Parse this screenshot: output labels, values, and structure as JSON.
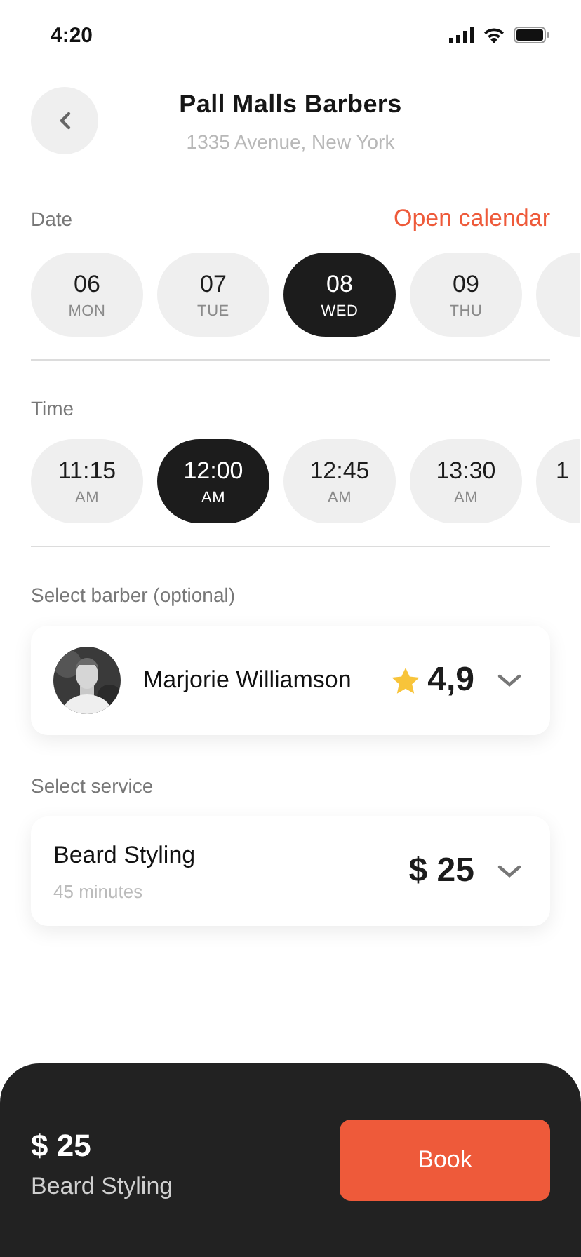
{
  "status_bar": {
    "time": "4:20"
  },
  "header": {
    "title": "Pall Malls Barbers",
    "address": "1335 Avenue, New York"
  },
  "date": {
    "label": "Date",
    "action": "Open calendar",
    "days": [
      {
        "kind": "pill",
        "number": "06",
        "weekday": "MON",
        "selected": false
      },
      {
        "kind": "pill",
        "number": "07",
        "weekday": "TUE",
        "selected": false
      },
      {
        "kind": "pill",
        "number": "08",
        "weekday": "WED",
        "selected": true
      },
      {
        "kind": "pill",
        "number": "09",
        "weekday": "THU",
        "selected": false
      },
      {
        "kind": "partial",
        "selected": false
      }
    ]
  },
  "time": {
    "label": "Time",
    "slots": [
      {
        "kind": "pill",
        "time": "11:15",
        "period": "AM",
        "selected": false
      },
      {
        "kind": "pill",
        "time": "12:00",
        "period": "AM",
        "selected": true
      },
      {
        "kind": "pill",
        "time": "12:45",
        "period": "AM",
        "selected": false
      },
      {
        "kind": "pill",
        "time": "13:30",
        "period": "AM",
        "selected": false
      },
      {
        "kind": "partial",
        "time": "1",
        "selected": false
      }
    ]
  },
  "barber": {
    "label": "Select barber (optional)",
    "name": "Marjorie Williamson",
    "rating": "4,9"
  },
  "service": {
    "label": "Select service",
    "name": "Beard Styling",
    "duration": "45 minutes",
    "price": "$ 25"
  },
  "footer": {
    "price": "$ 25",
    "service": "Beard Styling",
    "button": "Book"
  }
}
